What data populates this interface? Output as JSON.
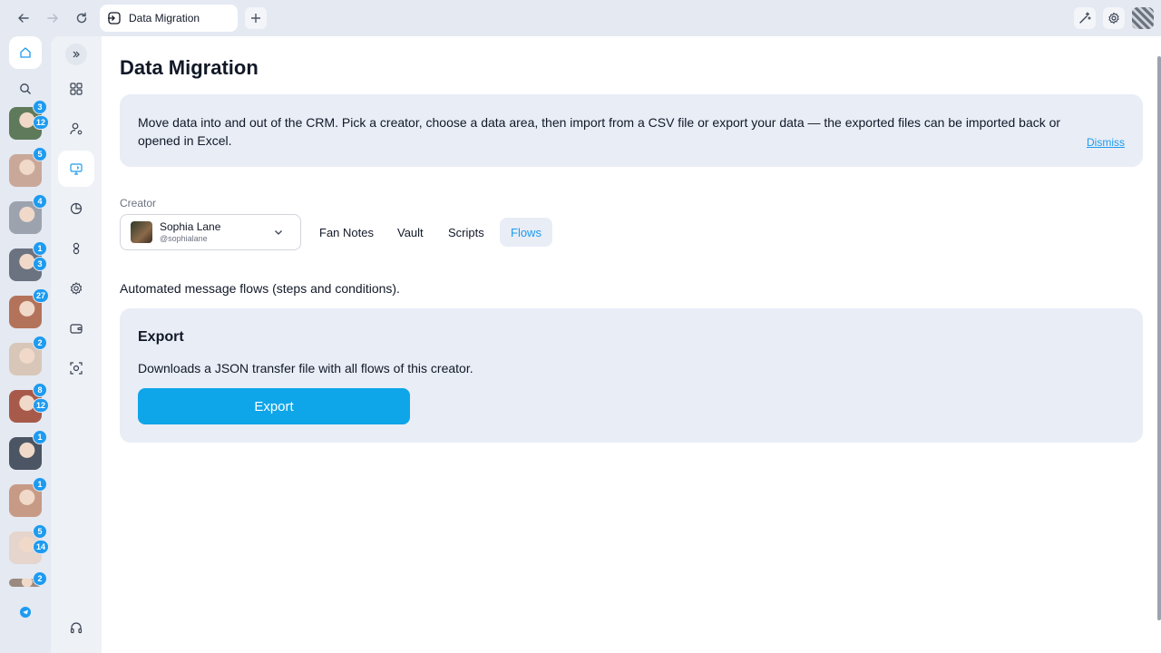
{
  "browser": {
    "tab_title": "Data Migration",
    "icons": {
      "back": "arrow-left-icon",
      "forward": "arrow-right-icon",
      "reload": "reload-icon",
      "new_tab": "plus-icon",
      "magic": "sparkle-wand-icon",
      "settings": "gear-icon"
    }
  },
  "creators": [
    {
      "badges": [
        "3",
        "12"
      ],
      "color": "#5f7a5a"
    },
    {
      "badges": [
        "5"
      ],
      "color": "#c9a89a"
    },
    {
      "badges": [
        "4"
      ],
      "color": "#9ca3af"
    },
    {
      "badges": [
        "1",
        "3"
      ],
      "color": "#6b7280"
    },
    {
      "badges": [
        "27"
      ],
      "color": "#b3735a"
    },
    {
      "badges": [
        "2"
      ],
      "color": "#d8c7b8"
    },
    {
      "badges": [
        "8",
        "12"
      ],
      "color": "#a85a4a"
    },
    {
      "badges": [
        "1"
      ],
      "color": "#4b5563"
    },
    {
      "badges": [
        "1"
      ],
      "color": "#c79a86"
    },
    {
      "badges": [
        "5",
        "14"
      ],
      "color": "#e5d5cc"
    },
    {
      "badges": [
        "2"
      ],
      "color": "#9a8a80"
    }
  ],
  "page": {
    "title": "Data Migration",
    "info_text": "Move data into and out of the CRM. Pick a creator, choose a data area, then import from a CSV file or export your data — the exported files can be imported back or opened in Excel.",
    "dismiss_label": "Dismiss",
    "creator_label": "Creator",
    "creator": {
      "name": "Sophia Lane",
      "handle": "@sophialane"
    },
    "tabs": [
      {
        "label": "Fan Notes",
        "active": false
      },
      {
        "label": "Vault",
        "active": false
      },
      {
        "label": "Scripts",
        "active": false
      },
      {
        "label": "Flows",
        "active": true
      }
    ],
    "section_desc": "Automated message flows (steps and conditions).",
    "export_card": {
      "title": "Export",
      "description": "Downloads a JSON transfer file with all flows of this creator.",
      "button_label": "Export"
    }
  },
  "colors": {
    "accent": "#1d9bf0",
    "button": "#0ea5e9",
    "panel": "#e8edf6"
  }
}
